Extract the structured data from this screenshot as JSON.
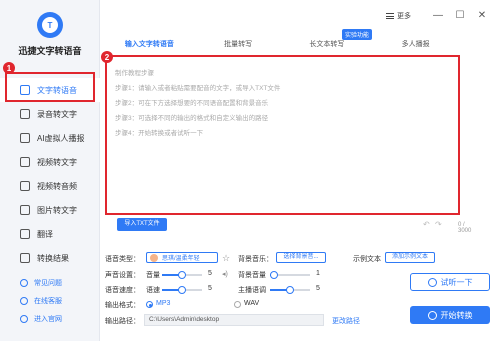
{
  "app": {
    "title": "迅捷文字转语音",
    "logo_text": "T"
  },
  "accent": "#2f7af5",
  "highlight": "#e0262e",
  "badges": {
    "one": "1",
    "two": "2"
  },
  "sidebar": {
    "items": [
      {
        "label": "文字转语音",
        "icon": "text-to-speech-icon",
        "active": true
      },
      {
        "label": "录音转文字",
        "icon": "recording-icon"
      },
      {
        "label": "AI虚拟人播报",
        "icon": "avatar-icon"
      },
      {
        "label": "视频转文字",
        "icon": "video-icon"
      },
      {
        "label": "视频转音频",
        "icon": "video-audio-icon"
      },
      {
        "label": "图片转文字",
        "icon": "image-icon"
      },
      {
        "label": "翻译",
        "icon": "translate-icon"
      },
      {
        "label": "转换结果",
        "icon": "results-icon"
      }
    ],
    "links": [
      {
        "label": "常见问题",
        "icon": "faq-icon"
      },
      {
        "label": "在线客服",
        "icon": "support-icon"
      },
      {
        "label": "进入官网",
        "icon": "website-icon"
      }
    ]
  },
  "topbar": {
    "more_label": "更多",
    "minimize": "—",
    "maximize": "☐",
    "close": "✕"
  },
  "tabs": [
    {
      "label": "输入文字转语音",
      "active": true
    },
    {
      "label": "批量转写"
    },
    {
      "label": "长文本转写"
    },
    {
      "label": "多人播报"
    }
  ],
  "tab_tag": "实验功能",
  "editor": {
    "lines": [
      "制作教程步骤",
      "步骤1：请输入或者粘贴需要配音的文字，或导入TXT文件",
      "步骤2：可在下方选择想要的不同语音配置和背景音乐",
      "步骤3：可选择不同的输出的格式和自定义输出的路径",
      "步骤4：开始转换或者试听一下"
    ],
    "import_label": "导入TXT文件",
    "undo": "↶",
    "redo": "↷",
    "count": "0 / 3000"
  },
  "settings": {
    "voice_type_label": "语音类型：",
    "voice_name": "思琪/温柔年轻",
    "star": "☆",
    "bgm_label": "背景音乐：",
    "bgm_button": "选择背景音...",
    "sample_label": "示例文本",
    "sample_button": "添加示例文本",
    "voice_setting_label": "声音设置：",
    "volume_label": "音量",
    "volume_value": "5",
    "volume_level": 0.5,
    "bg_volume_label": "背景音量",
    "bg_volume_value": "1",
    "bg_volume_level": 0.1,
    "speed_label": "语音速度：",
    "speed_sub": "语速",
    "speed_value": "5",
    "speed_level": 0.5,
    "pitch_label": "主播语调",
    "pitch_value": "5",
    "pitch_level": 0.5,
    "format_label": "输出格式：",
    "format_mp3": "MP3",
    "format_wav": "WAV",
    "path_label": "输出路径：",
    "path_value": "C:\\Users\\Admin\\desktop",
    "change_path": "更改路径",
    "listen_button": "试听一下",
    "start_button": "开始转换"
  }
}
